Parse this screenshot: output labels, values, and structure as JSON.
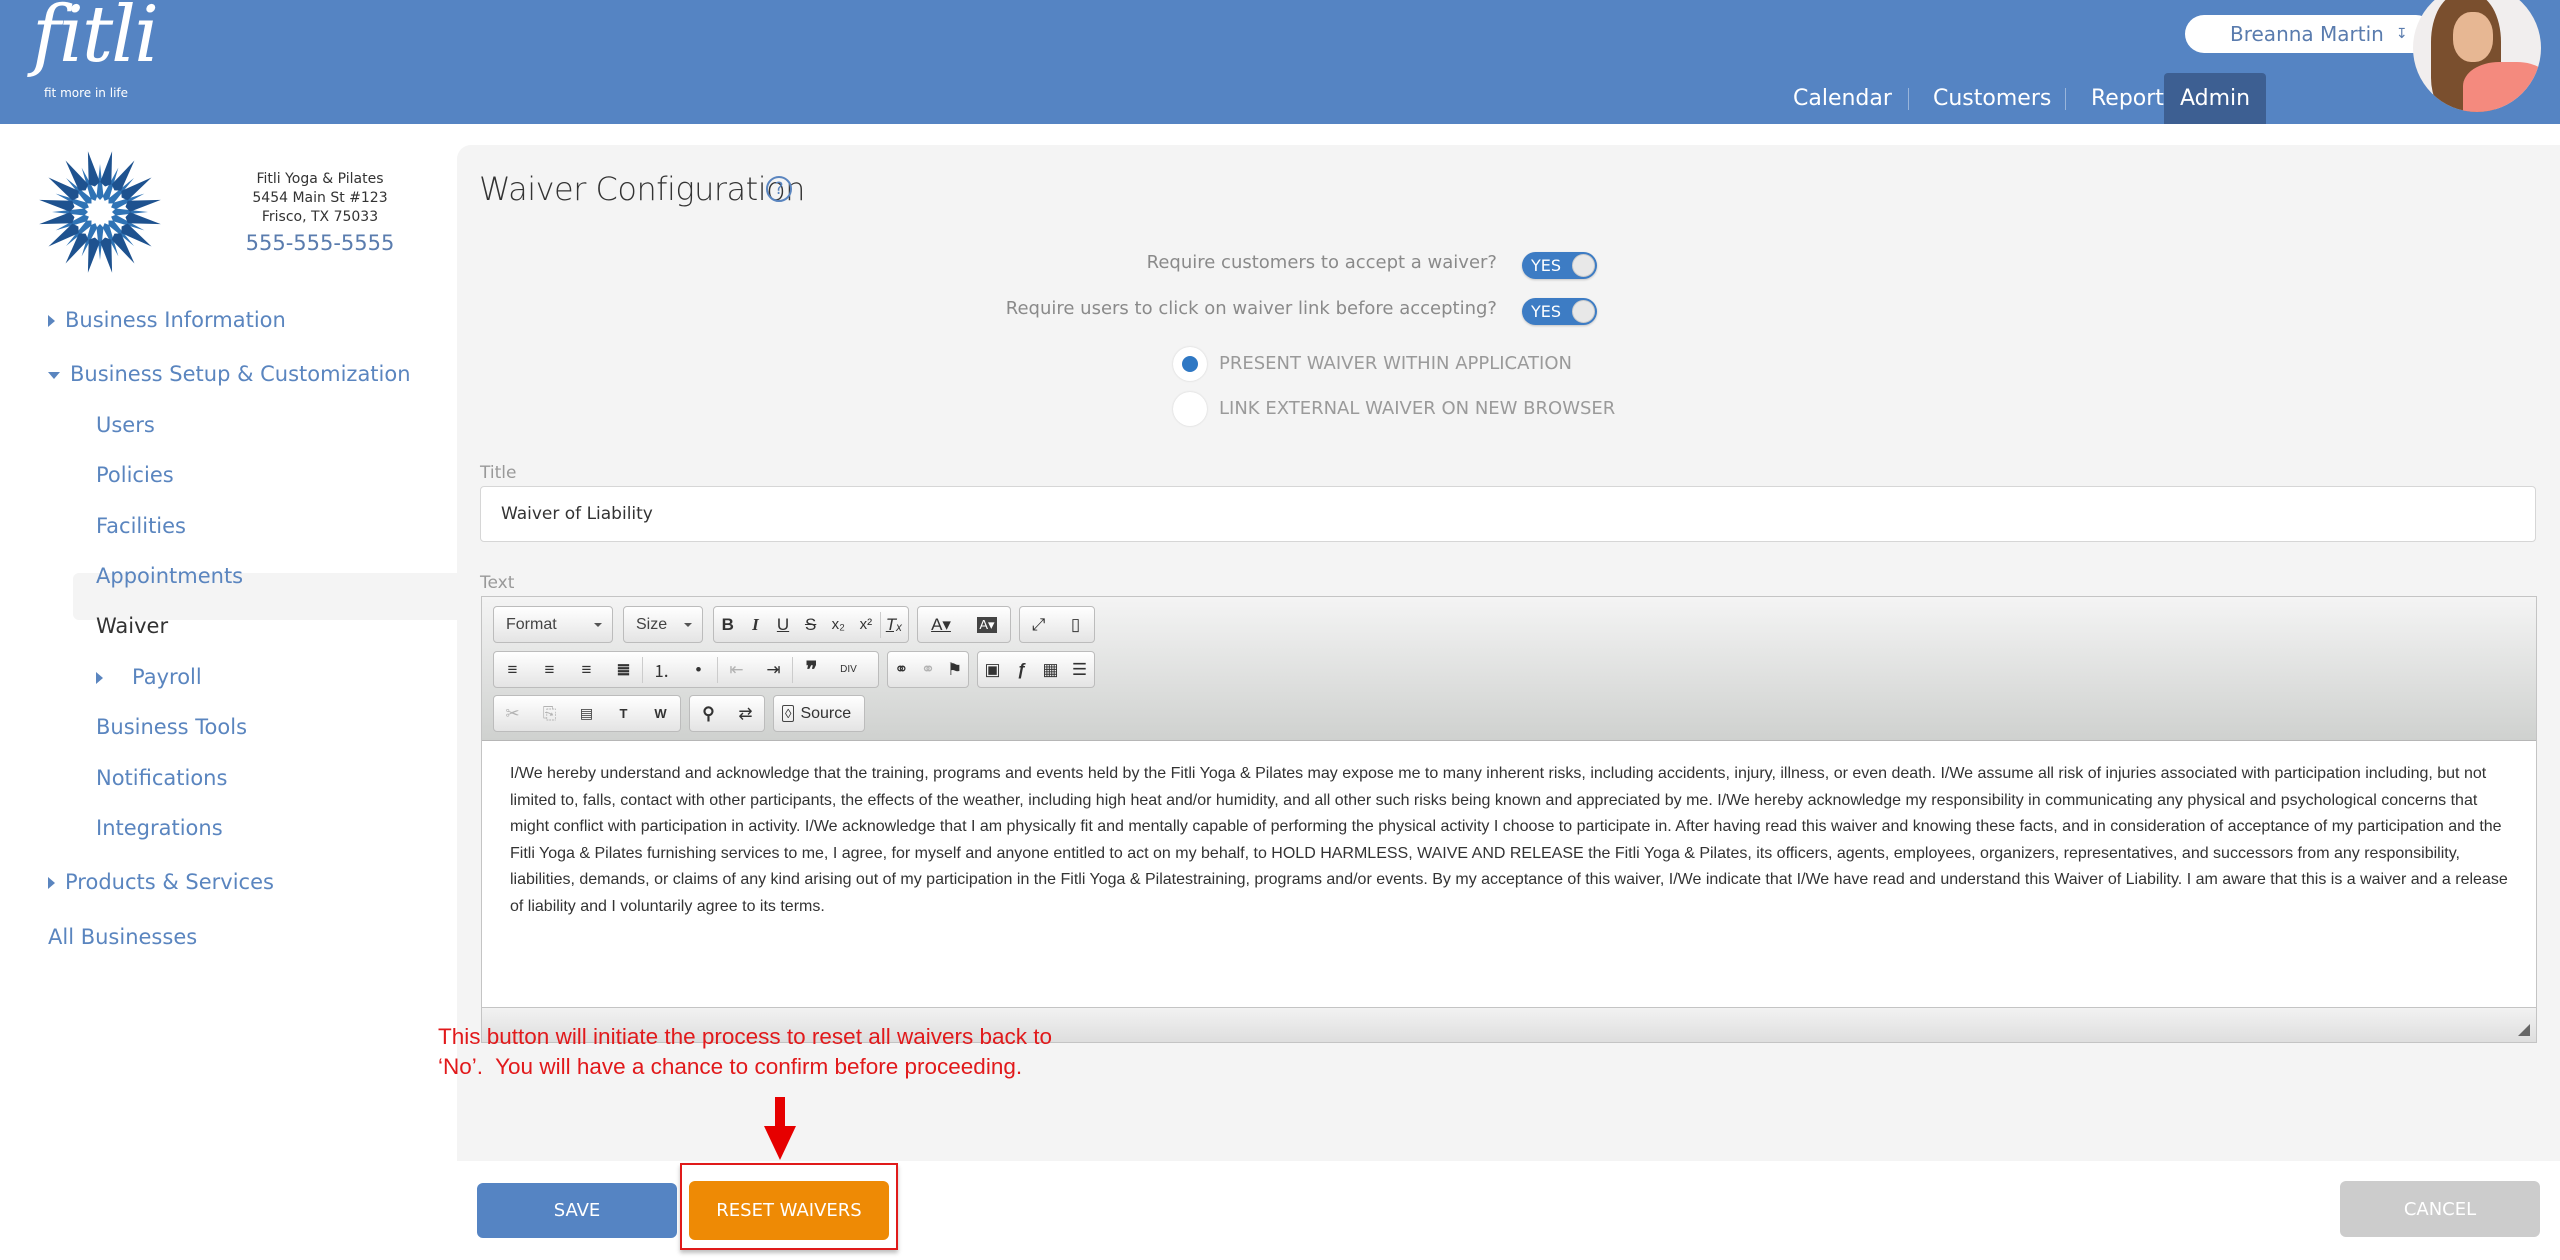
{
  "brand": {
    "name": "fitli",
    "tagline": "fit more in life",
    "color": "#5584c3"
  },
  "user": {
    "name": "Breanna Martin",
    "menu_icon": "double-chevron-down-icon"
  },
  "nav": {
    "items": [
      {
        "label": "Calendar"
      },
      {
        "label": "Customers"
      },
      {
        "label": "Reports"
      },
      {
        "label": "Admin",
        "active": true
      }
    ]
  },
  "business": {
    "name": "Fitli Yoga & Pilates",
    "address1": "5454 Main St #123",
    "address2": "Frisco, TX 75033",
    "phone": "555-555-5555"
  },
  "sidebar": {
    "items": [
      {
        "label": "Business Information",
        "caret": "right",
        "level": 0
      },
      {
        "label": "Business Setup & Customization",
        "caret": "down",
        "level": 0
      },
      {
        "label": "Users",
        "level": 1
      },
      {
        "label": "Policies",
        "level": 1
      },
      {
        "label": "Facilities",
        "level": 1
      },
      {
        "label": "Appointments",
        "level": 1
      },
      {
        "label": "Waiver",
        "level": 1,
        "active": true
      },
      {
        "label": "Payroll",
        "caret": "right",
        "level": 1
      },
      {
        "label": "Business Tools",
        "level": 1
      },
      {
        "label": "Notifications",
        "level": 1
      },
      {
        "label": "Integrations",
        "level": 1
      },
      {
        "label": "Products & Services",
        "caret": "right",
        "level": 0
      },
      {
        "label": "All Businesses",
        "level": 0
      }
    ]
  },
  "main": {
    "title": "Waiver Configuration",
    "help_icon": "?",
    "toggles": [
      {
        "label": "Require customers to accept a waiver?",
        "value": "YES"
      },
      {
        "label": "Require users to click on waiver link before accepting?",
        "value": "YES"
      }
    ],
    "radios": [
      {
        "label": "PRESENT WAIVER WITHIN APPLICATION",
        "selected": true
      },
      {
        "label": "LINK EXTERNAL WAIVER ON NEW BROWSER",
        "selected": false
      }
    ],
    "title_field": {
      "label": "Title",
      "value": "Waiver of Liability"
    },
    "text_field": {
      "label": "Text"
    },
    "editor": {
      "format_label": "Format",
      "size_label": "Size",
      "source_label": "Source",
      "toolbar_icons": {
        "bold": "B",
        "italic": "I",
        "underline": "U",
        "strike": "S",
        "subscript": "x₂",
        "superscript": "x²",
        "remove_format": "Tₓ",
        "text_color": "A▾",
        "bg_color": "A▾",
        "maximize": "⤢",
        "show_blocks": "▯",
        "align_left": "≡",
        "align_center": "≡",
        "align_right": "≡",
        "justify": "≣",
        "numbered_list": "⒈",
        "bulleted_list": "•",
        "outdent": "⇤",
        "indent": "⇥",
        "blockquote": "❞",
        "div": "DIV",
        "link": "🔗",
        "unlink": "⛓",
        "anchor": "⚑",
        "image": "▣",
        "flash": "ƒ",
        "table": "▦",
        "hline": "☰",
        "cut": "✂",
        "copy": "⎘",
        "paste": "📋",
        "paste_text": "T",
        "paste_word": "W",
        "find": "🔍",
        "replace": "⇄"
      },
      "body": "I/We hereby understand and acknowledge that the training, programs and events held by the Fitli Yoga & Pilates may expose me to many inherent risks, including accidents, injury, illness, or even death. I/We assume all risk of injuries associated with participation including, but not limited to, falls, contact with other participants, the effects of the weather, including high heat and/or humidity, and all other such risks being known and appreciated by me. I/We hereby acknowledge my responsibility in communicating any physical and psychological concerns that might conflict with participation in activity. I/We acknowledge that I am physically fit and mentally capable of performing the physical activity I choose to participate in. After having read this waiver and knowing these facts, and in consideration of acceptance of my participation and the Fitli Yoga & Pilates furnishing services to me, I agree, for myself and anyone entitled to act on my behalf, to HOLD HARMLESS, WAIVE AND RELEASE the Fitli Yoga & Pilates, its officers, agents, employees, organizers, representatives, and successors from any responsibility, liabilities, demands, or claims of any kind arising out of my participation in the Fitli Yoga & Pilatestraining, programs and/or events. By my acceptance of this waiver, I/We indicate that I/We have read and understand this Waiver of Liability. I am aware that this is a waiver and a release of liability and I voluntarily agree to its terms."
    }
  },
  "annotation": {
    "text": "This button will initiate the process to reset all waivers back to\n‘No’.  You will have a chance to confirm before proceeding.",
    "color": "#e1191b"
  },
  "footer": {
    "save_label": "SAVE",
    "reset_label": "RESET WAIVERS",
    "cancel_label": "CANCEL",
    "reset_color": "#ee8a05",
    "save_color": "#5584c3"
  }
}
